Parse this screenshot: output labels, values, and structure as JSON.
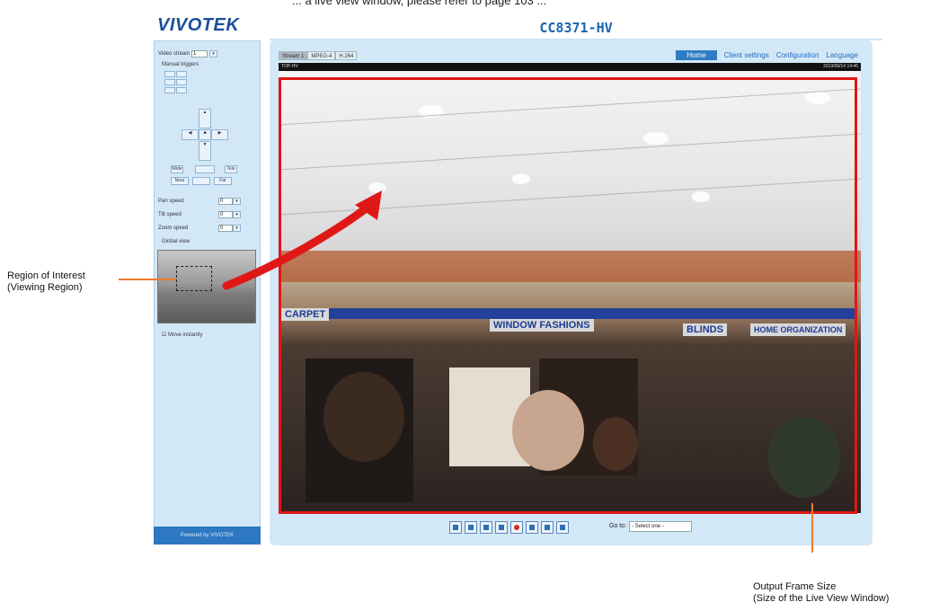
{
  "top_clip_text": "... a live view window, please refer to page 103 ...",
  "brand": {
    "logo": "VIVOTEK",
    "model": "CC8371-HV"
  },
  "sidebar": {
    "video_stream_label": "Video stream",
    "video_stream_value": "1",
    "manual_triggers": "Manual triggers",
    "pan_speed_label": "Pan speed",
    "tilt_speed_label": "Tilt speed",
    "zoom_speed_label": "Zoom speed",
    "speed_value": "0",
    "global_view": "Global view",
    "move_instantly": "Move instantly",
    "footer": "Powered by VIVOTEK",
    "btn_wide": "Wide",
    "btn_tele": "Tele",
    "btn_near": "Near",
    "btn_far": "Far"
  },
  "tabs": [
    "Stream 1",
    "MPEG-4",
    "H.264"
  ],
  "nav": {
    "home": "Home",
    "client_settings": "Client settings",
    "configuration": "Configuration",
    "language": "Language"
  },
  "video": {
    "overlay_left": "TOP-HV",
    "overlay_right": "2013/06/14 14:46",
    "banner_carpet": "CARPET",
    "banner_window": "WINDOW FASHIONS",
    "banner_blinds": "BLINDS",
    "banner_home": "HOME ORGANIZATION"
  },
  "controls": {
    "icons": [
      "snapshot-icon",
      "zoom-icon",
      "pause-icon",
      "stop-icon",
      "record-icon",
      "volume-icon",
      "mic-icon",
      "fullscreen-icon"
    ],
    "goto_label": "Go to:",
    "goto_select": "- Select one -"
  },
  "callouts": {
    "roi_line1": "Region of Interest",
    "roi_line2": "(Viewing Region)",
    "out_line1": "Output Frame Size",
    "out_line2": "(Size of the Live View Window)"
  },
  "colors": {
    "accent": "#2f7cc4",
    "frame": "#e01717",
    "callout": "#f07a2b"
  }
}
